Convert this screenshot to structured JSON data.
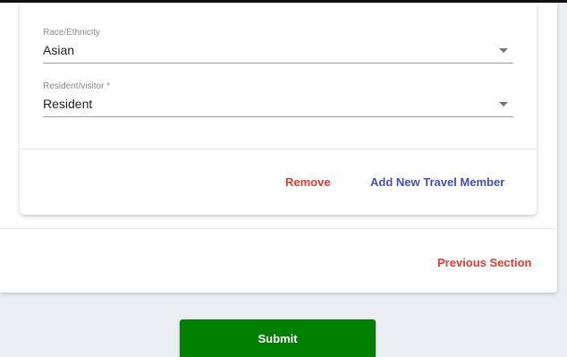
{
  "travel_member": {
    "race_field": {
      "label": "Race/Ethnicity",
      "value": "Asian"
    },
    "resident_field": {
      "label": "Resident/visitor *",
      "value": "Resident"
    },
    "remove_label": "Remove",
    "add_member_label": "Add New Travel Member"
  },
  "section": {
    "previous_label": "Previous Section"
  },
  "form": {
    "submit_label": "Submit"
  },
  "colors": {
    "accent_red": "#e53935",
    "accent_blue": "#3f51b5",
    "submit_green": "#008000",
    "page_background": "#eceff1"
  },
  "icons": [
    "dropdown-caret-icon"
  ]
}
